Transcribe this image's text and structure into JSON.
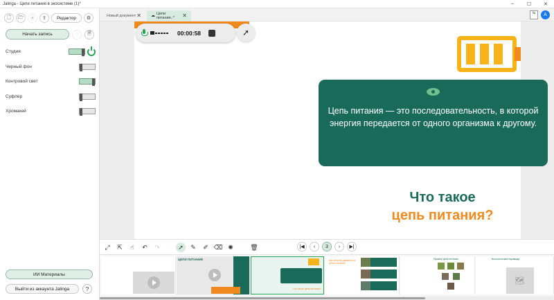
{
  "window": {
    "title": "Jalinga - Цепи питания в экосистеме (1)*",
    "controls": [
      "–",
      "☐",
      "✕"
    ]
  },
  "sidebar": {
    "toolbar": {
      "editor_label": "Редактор"
    },
    "record_button": "Начать запись",
    "settings": [
      {
        "label": "Студия",
        "on": true
      },
      {
        "label": "Черный фон",
        "on": false
      },
      {
        "label": "Контровой свет",
        "on": true
      },
      {
        "label": "Суфлер",
        "on": false
      },
      {
        "label": "Хромакей",
        "on": false
      }
    ],
    "ai_button": "ИИ Материалы",
    "logout_button": "Выйти из аккаунта Jalinga",
    "help": "?"
  },
  "tabs": [
    {
      "label": "Новый документ",
      "active": false
    },
    {
      "label": "Цепи питания..*",
      "active": true
    }
  ],
  "account": {
    "avatar_letter": "A"
  },
  "recorder": {
    "timer": "00:00:58"
  },
  "slide": {
    "box_text": "Цепь питания — это последовательность, в которой энергия передается от одного организма к другому.",
    "headline_line1": "Что такое",
    "headline_line2": "цепь питания?"
  },
  "navigation": {
    "current_page": "3"
  },
  "thumbnails": [
    {
      "text": ""
    },
    {
      "text": "ЦЕПИ ПИТАНИЯ"
    },
    {
      "text": "Что такое цепь питания?"
    },
    {
      "text": "Как энергия движется в цепях питания"
    },
    {
      "text": "Пример цепи питания"
    },
    {
      "text": "Экологическая пирамида"
    }
  ],
  "colors": {
    "accent_green": "#1a6a5a",
    "accent_orange": "#f08a1e",
    "ui_green": "#27a35a"
  }
}
